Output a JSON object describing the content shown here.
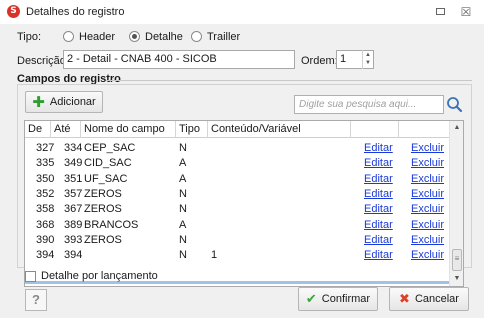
{
  "window": {
    "title": "Detalhes do registro",
    "app_icon_letter": "S",
    "restore_icon": "restore-icon",
    "close_glyph": "☒"
  },
  "form": {
    "tipo_label": "Tipo:",
    "radio_options": [
      {
        "label": "Header",
        "checked": false
      },
      {
        "label": "Detalhe",
        "checked": true
      },
      {
        "label": "Trailler",
        "checked": false
      }
    ],
    "descricao_label": "Descrição:",
    "descricao_value": "2 - Detail - CNAB 400 - SICOB",
    "ordem_label": "Ordem:",
    "ordem_value": "1"
  },
  "campos": {
    "section_title": "Campos do registro",
    "add_button_label": "Adicionar",
    "search_placeholder": "Digite sua pesquisa aqui...",
    "columns": [
      "De",
      "Até",
      "Nome do campo",
      "Tipo",
      "Conteúdo/Variável",
      "",
      ""
    ],
    "rows": [
      {
        "de": "327",
        "ate": "334",
        "nome": "CEP_SAC",
        "tipo": "N",
        "conteudo": "",
        "edit": "Editar",
        "delete": "Excluir"
      },
      {
        "de": "335",
        "ate": "349",
        "nome": "CID_SAC",
        "tipo": "A",
        "conteudo": "",
        "edit": "Editar",
        "delete": "Excluir"
      },
      {
        "de": "350",
        "ate": "351",
        "nome": "UF_SAC",
        "tipo": "A",
        "conteudo": "",
        "edit": "Editar",
        "delete": "Excluir"
      },
      {
        "de": "352",
        "ate": "357",
        "nome": "ZEROS",
        "tipo": "N",
        "conteudo": "",
        "edit": "Editar",
        "delete": "Excluir"
      },
      {
        "de": "358",
        "ate": "367",
        "nome": "ZEROS",
        "tipo": "N",
        "conteudo": "",
        "edit": "Editar",
        "delete": "Excluir"
      },
      {
        "de": "368",
        "ate": "389",
        "nome": "BRANCOS",
        "tipo": "A",
        "conteudo": "",
        "edit": "Editar",
        "delete": "Excluir"
      },
      {
        "de": "390",
        "ate": "393",
        "nome": "ZEROS",
        "tipo": "N",
        "conteudo": "",
        "edit": "Editar",
        "delete": "Excluir"
      },
      {
        "de": "394",
        "ate": "394",
        "nome": "",
        "tipo": "N",
        "conteudo": "1",
        "edit": "Editar",
        "delete": "Excluir"
      }
    ]
  },
  "footer": {
    "checkbox_label": "Detalhe por lançamento",
    "checkbox_checked": false,
    "help_label": "?",
    "confirm_label": "Confirmar",
    "cancel_label": "Cancelar"
  },
  "colors": {
    "link": "#1a3ad8",
    "confirm_check": "#3aa33a",
    "cancel_x": "#d9422b",
    "add_plus": "#2f9e2f",
    "app_icon": "#d8332a"
  }
}
